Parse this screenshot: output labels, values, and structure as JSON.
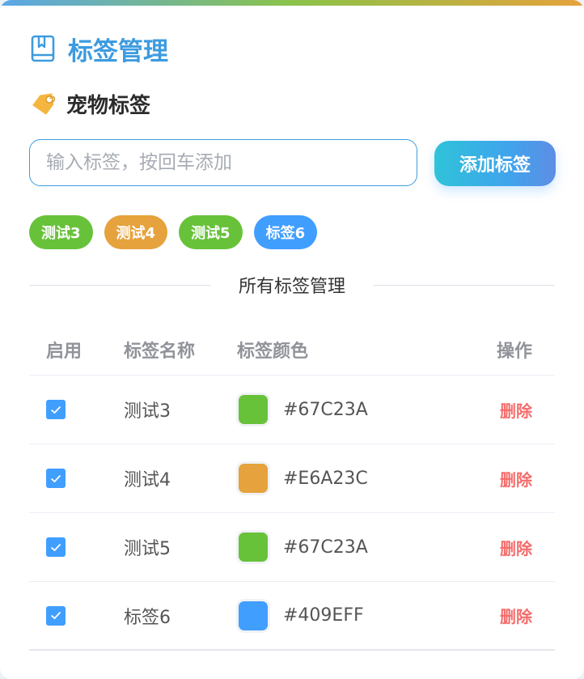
{
  "header": {
    "title": "标签管理",
    "icon": "book-icon"
  },
  "section": {
    "title": "宠物标签",
    "icon": "tag-icon"
  },
  "input": {
    "placeholder": "输入标签，按回车添加",
    "value": ""
  },
  "add_button": {
    "label": "添加标签"
  },
  "chips": [
    {
      "label": "测试3",
      "color": "#67C23A"
    },
    {
      "label": "测试4",
      "color": "#E6A23C"
    },
    {
      "label": "测试5",
      "color": "#67C23A"
    },
    {
      "label": "标签6",
      "color": "#409EFF"
    }
  ],
  "divider": {
    "text": "所有标签管理"
  },
  "table": {
    "headers": {
      "enabled": "启用",
      "name": "标签名称",
      "color": "标签颜色",
      "action": "操作"
    },
    "rows": [
      {
        "enabled": true,
        "name": "测试3",
        "color": "#67C23A",
        "hex": "#67C23A",
        "action": "删除"
      },
      {
        "enabled": true,
        "name": "测试4",
        "color": "#E6A23C",
        "hex": "#E6A23C",
        "action": "删除"
      },
      {
        "enabled": true,
        "name": "测试5",
        "color": "#67C23A",
        "hex": "#67C23A",
        "action": "删除"
      },
      {
        "enabled": true,
        "name": "标签6",
        "color": "#409EFF",
        "hex": "#409EFF",
        "action": "删除"
      }
    ]
  },
  "colors": {
    "accent": "#3D9BE0",
    "delete": "#F56C6C",
    "checkbox": "#409EFF"
  }
}
